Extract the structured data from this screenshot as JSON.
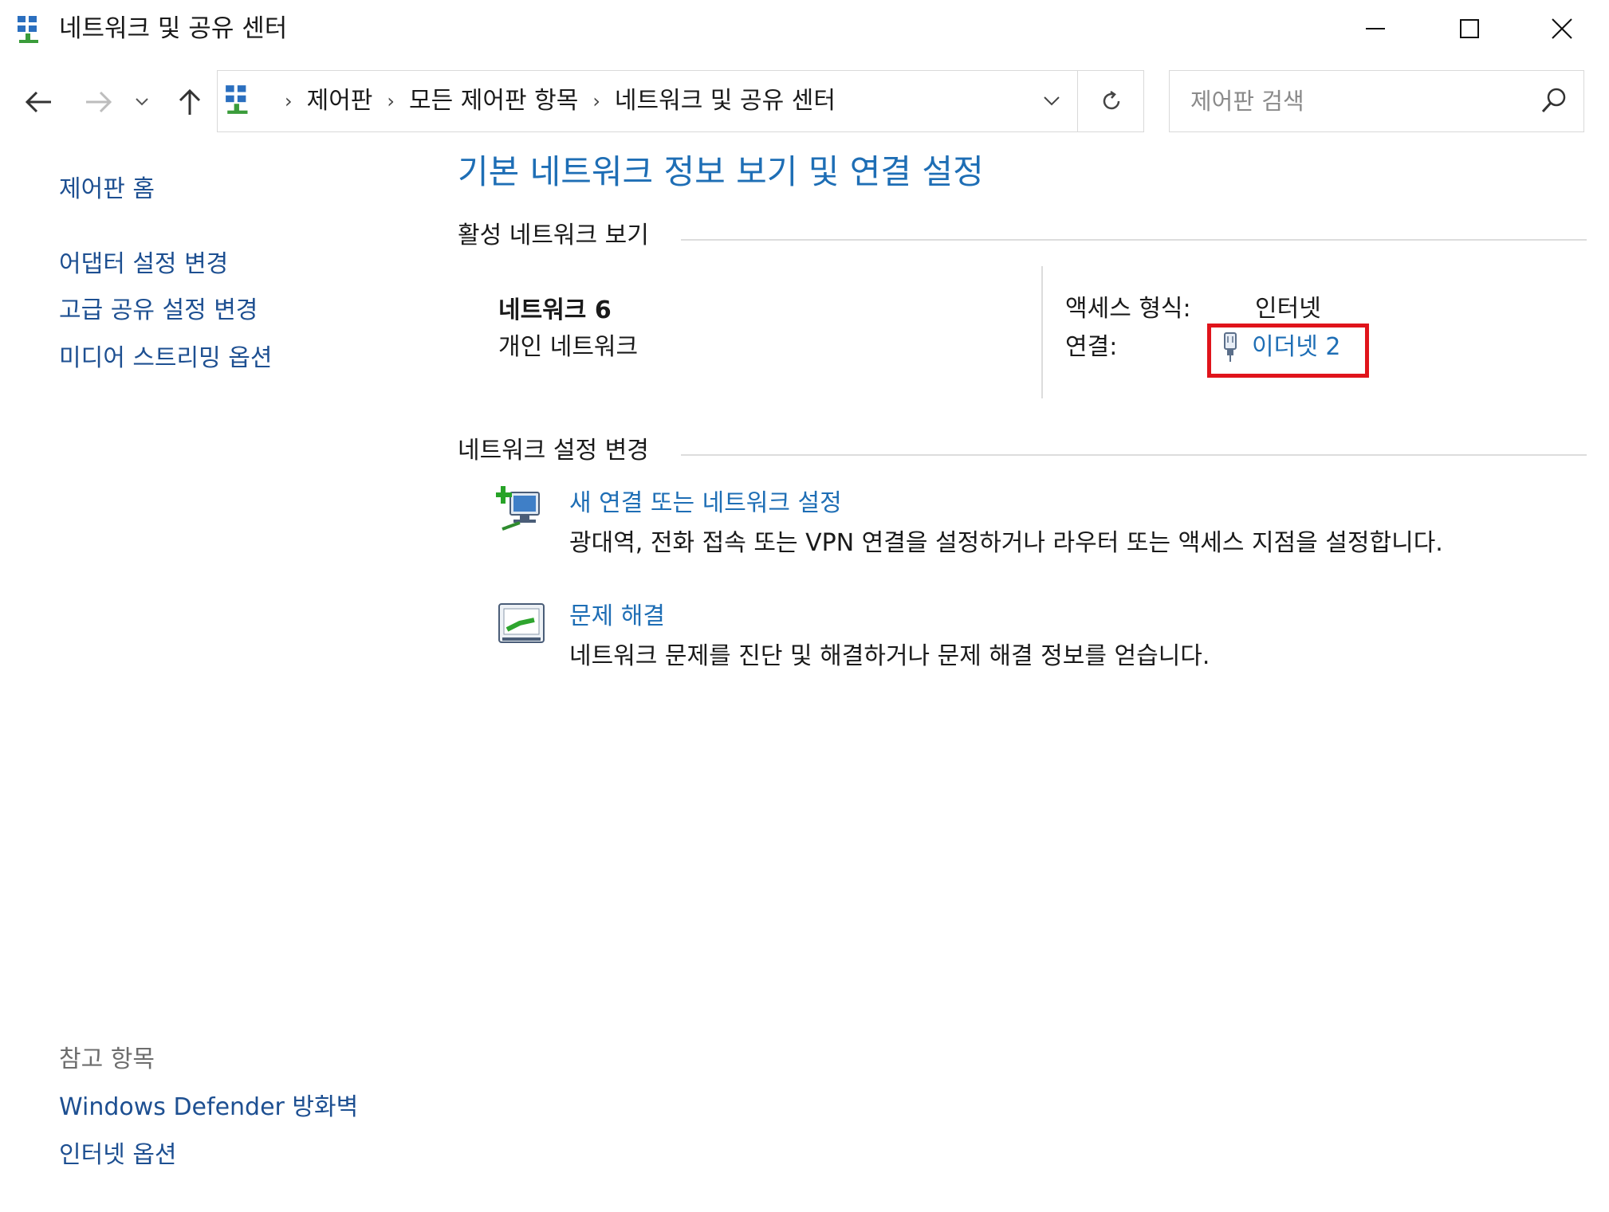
{
  "window": {
    "title": "네트워크 및 공유 센터",
    "minimize_icon": "minimize-icon",
    "maximize_icon": "maximize-icon",
    "close_icon": "close-icon"
  },
  "nav": {
    "breadcrumbs": [
      "제어판",
      "모든 제어판 항목",
      "네트워크 및 공유 센터"
    ],
    "search_placeholder": "제어판 검색"
  },
  "left_panel": {
    "home": "제어판 홈",
    "links": [
      "어댑터 설정 변경",
      "고급 공유 설정 변경",
      "미디어 스트리밍 옵션"
    ],
    "see_also_header": "참고 항목",
    "see_also_links": [
      "Windows Defender 방화벽",
      "인터넷 옵션"
    ]
  },
  "main": {
    "title": "기본 네트워크 정보 보기 및 연결 설정",
    "active_section": "활성 네트워크 보기",
    "network": {
      "name": "네트워크 6",
      "category": "개인 네트워크",
      "access_label": "액세스 형식:",
      "access_value": "인터넷",
      "connection_label": "연결:",
      "connection_value": "이더넷 2"
    },
    "change_section": "네트워크 설정 변경",
    "tasks": [
      {
        "title": "새 연결 또는 네트워크 설정",
        "description": "광대역, 전화 접속 또는 VPN 연결을 설정하거나 라우터 또는 액세스 지점을 설정합니다."
      },
      {
        "title": "문제 해결",
        "description": "네트워크 문제를 진단 및 해결하거나 문제 해결 정보를 얻습니다."
      }
    ]
  },
  "colors": {
    "link": "#1e6eb5",
    "highlight": "#e0141b"
  }
}
